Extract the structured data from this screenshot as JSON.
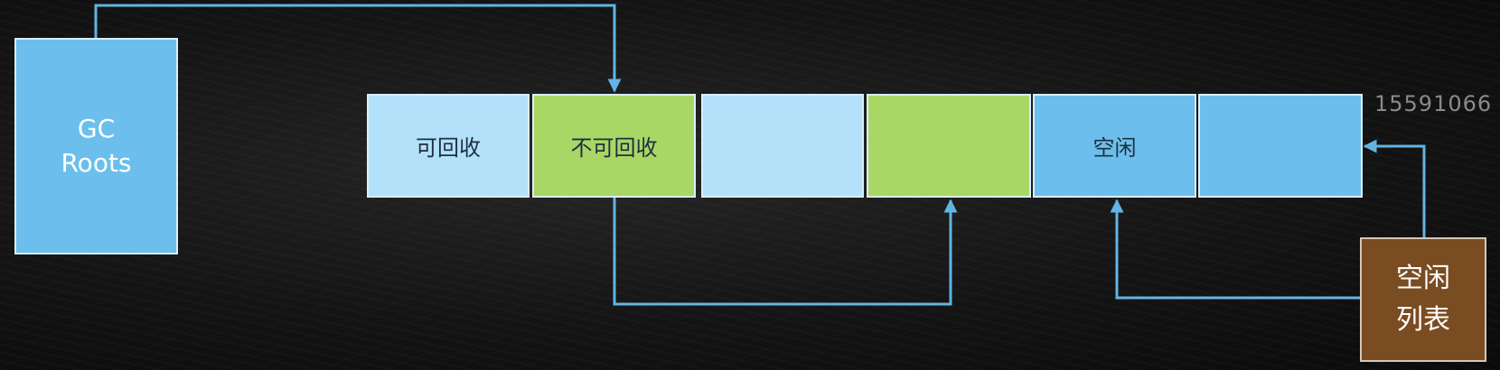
{
  "gc_roots": {
    "label": "GC\nRoots"
  },
  "memory_cells": [
    {
      "label": "可回收",
      "state": "reclaimable",
      "color": "#b3e1fa"
    },
    {
      "label": "不可回收",
      "state": "reachable",
      "color": "#a8d765"
    },
    {
      "label": "",
      "state": "reclaimable",
      "color": "#b3e1fa"
    },
    {
      "label": "",
      "state": "reachable",
      "color": "#a8d765"
    },
    {
      "label": "空闲",
      "state": "free",
      "color": "#6cbfec"
    },
    {
      "label": "",
      "state": "free",
      "color": "#6cbfec"
    }
  ],
  "free_list": {
    "label": "空闲\n列表",
    "color": "#7a4c22"
  },
  "watermark": "15591066",
  "colors": {
    "arrow": "#62b4e4",
    "background": "#141414"
  }
}
